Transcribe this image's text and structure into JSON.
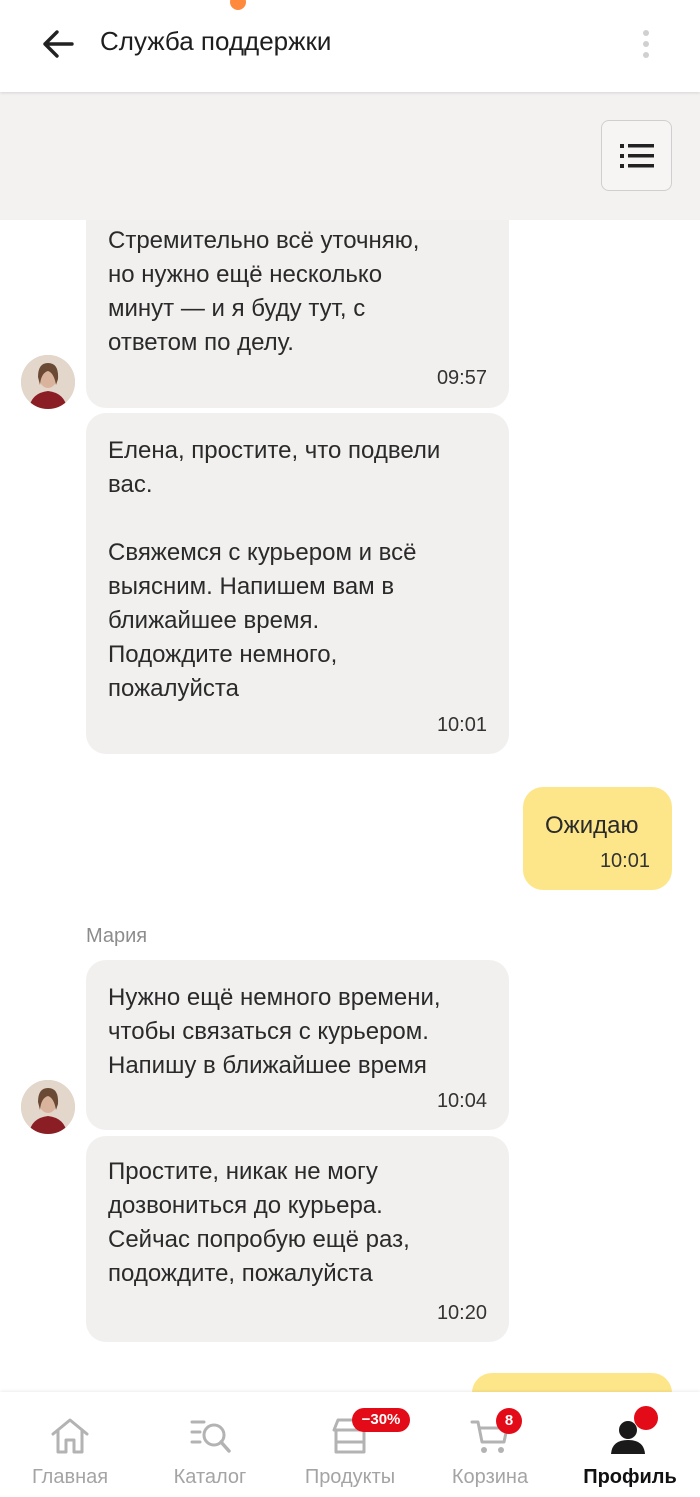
{
  "header": {
    "title": "Служба поддержки",
    "back_icon": "arrow-left-icon",
    "more_icon": "more-vertical-icon"
  },
  "toolbar": {
    "menu_icon": "list-icon"
  },
  "messages": [
    {
      "side": "in",
      "text": "Стремительно всё уточняю,\nно нужно ещё несколько\nминут — и я буду тут, с\nответом по делу.",
      "time": "09:57"
    },
    {
      "side": "in",
      "text": "Елена, простите, что подвели\nвас.\n\nСвяжемся с курьером и всё\nвыясним. Напишем вам в\nближайшее время.\nПодождите немного,\nпожалуйста",
      "time": "10:01"
    },
    {
      "side": "out",
      "text": "Ожидаю",
      "time": "10:01"
    },
    {
      "side": "in",
      "sender": "Мария",
      "text": "Нужно ещё немного времени,\nчтобы связаться с курьером.\nНапишу в ближайшее время",
      "time": "10:04"
    },
    {
      "side": "in",
      "text": "Простите, никак не могу\nдозвониться до курьера.\nСейчас попробую ещё раз,\nподождите, пожалуйста",
      "time": "10:20"
    },
    {
      "side": "out",
      "text": "",
      "time": ""
    }
  ],
  "nav": {
    "items": [
      {
        "label": "Главная",
        "icon": "home-icon"
      },
      {
        "label": "Каталог",
        "icon": "catalog-search-icon"
      },
      {
        "label": "Продукты",
        "icon": "store-icon",
        "badge": "−30%"
      },
      {
        "label": "Корзина",
        "icon": "cart-icon",
        "badge": "8"
      },
      {
        "label": "Профиль",
        "icon": "profile-icon",
        "active": true
      }
    ]
  },
  "colors": {
    "incoming_bubble": "#f1f0ef",
    "outgoing_bubble": "#fde68a",
    "badge": "#e30b17"
  }
}
